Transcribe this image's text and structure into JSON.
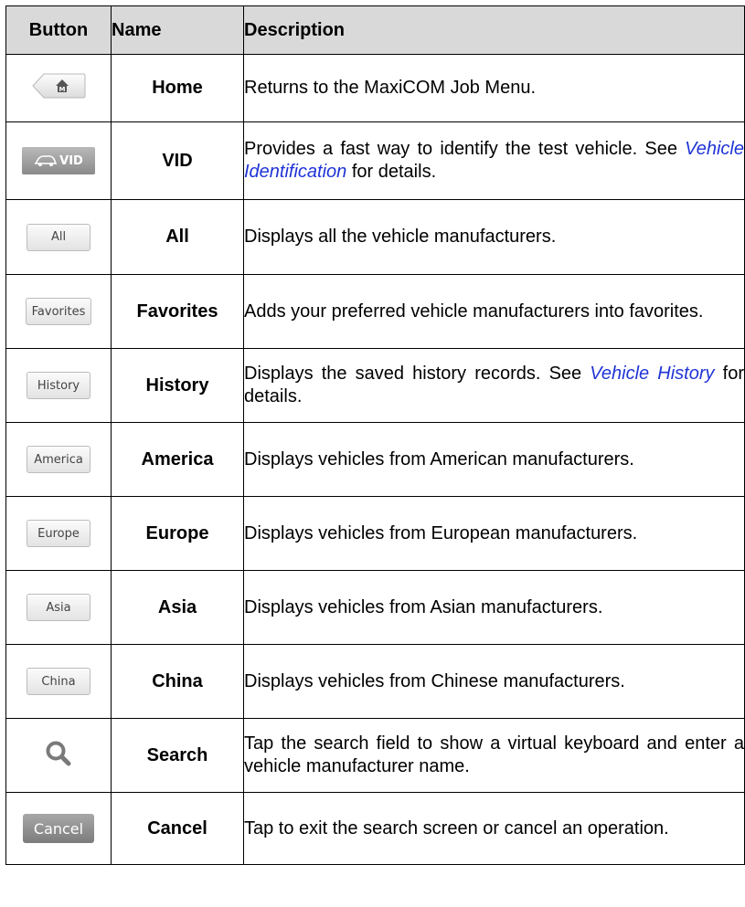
{
  "header": {
    "button": "Button",
    "name": "Name",
    "description": "Description"
  },
  "rows": [
    {
      "icon_name": "home-icon",
      "icon_label": "",
      "name": "Home",
      "desc_a": "Returns to the MaxiCOM Job Menu.",
      "link": "",
      "desc_b": ""
    },
    {
      "icon_name": "vid-icon",
      "icon_label": "VID",
      "name": "VID",
      "desc_a": "Provides a fast way to identify the test vehicle. See ",
      "link": "Vehicle Identification",
      "desc_b": " for details."
    },
    {
      "icon_name": "all-button-icon",
      "icon_label": "All",
      "name": "All",
      "desc_a": "Displays all the vehicle manufacturers.",
      "link": "",
      "desc_b": ""
    },
    {
      "icon_name": "favorites-button-icon",
      "icon_label": "Favorites",
      "name": "Favorites",
      "desc_a": "Adds your preferred vehicle manufacturers into favorites.",
      "link": "",
      "desc_b": ""
    },
    {
      "icon_name": "history-button-icon",
      "icon_label": "History",
      "name": "History",
      "desc_a": "Displays the saved history records. See ",
      "link": "Vehicle History",
      "desc_b": " for details."
    },
    {
      "icon_name": "america-button-icon",
      "icon_label": "America",
      "name": "America",
      "desc_a": "Displays vehicles from American manufacturers.",
      "link": "",
      "desc_b": ""
    },
    {
      "icon_name": "europe-button-icon",
      "icon_label": "Europe",
      "name": "Europe",
      "desc_a": "Displays vehicles from European manufacturers.",
      "link": "",
      "desc_b": ""
    },
    {
      "icon_name": "asia-button-icon",
      "icon_label": "Asia",
      "name": "Asia",
      "desc_a": "Displays vehicles from Asian manufacturers.",
      "link": "",
      "desc_b": ""
    },
    {
      "icon_name": "china-button-icon",
      "icon_label": "China",
      "name": "China",
      "desc_a": "Displays vehicles from Chinese manufacturers.",
      "link": "",
      "desc_b": ""
    },
    {
      "icon_name": "search-icon",
      "icon_label": "",
      "name": "Search",
      "desc_a": "Tap the search field to show a virtual keyboard and enter a vehicle manufacturer name.",
      "link": "",
      "desc_b": ""
    },
    {
      "icon_name": "cancel-button-icon",
      "icon_label": "Cancel",
      "name": "Cancel",
      "desc_a": "Tap to exit the search screen or cancel an operation.",
      "link": "",
      "desc_b": ""
    }
  ],
  "colors": {
    "header_bg": "#d9d9d9",
    "link": "#1f33d6",
    "border": "#000000"
  }
}
